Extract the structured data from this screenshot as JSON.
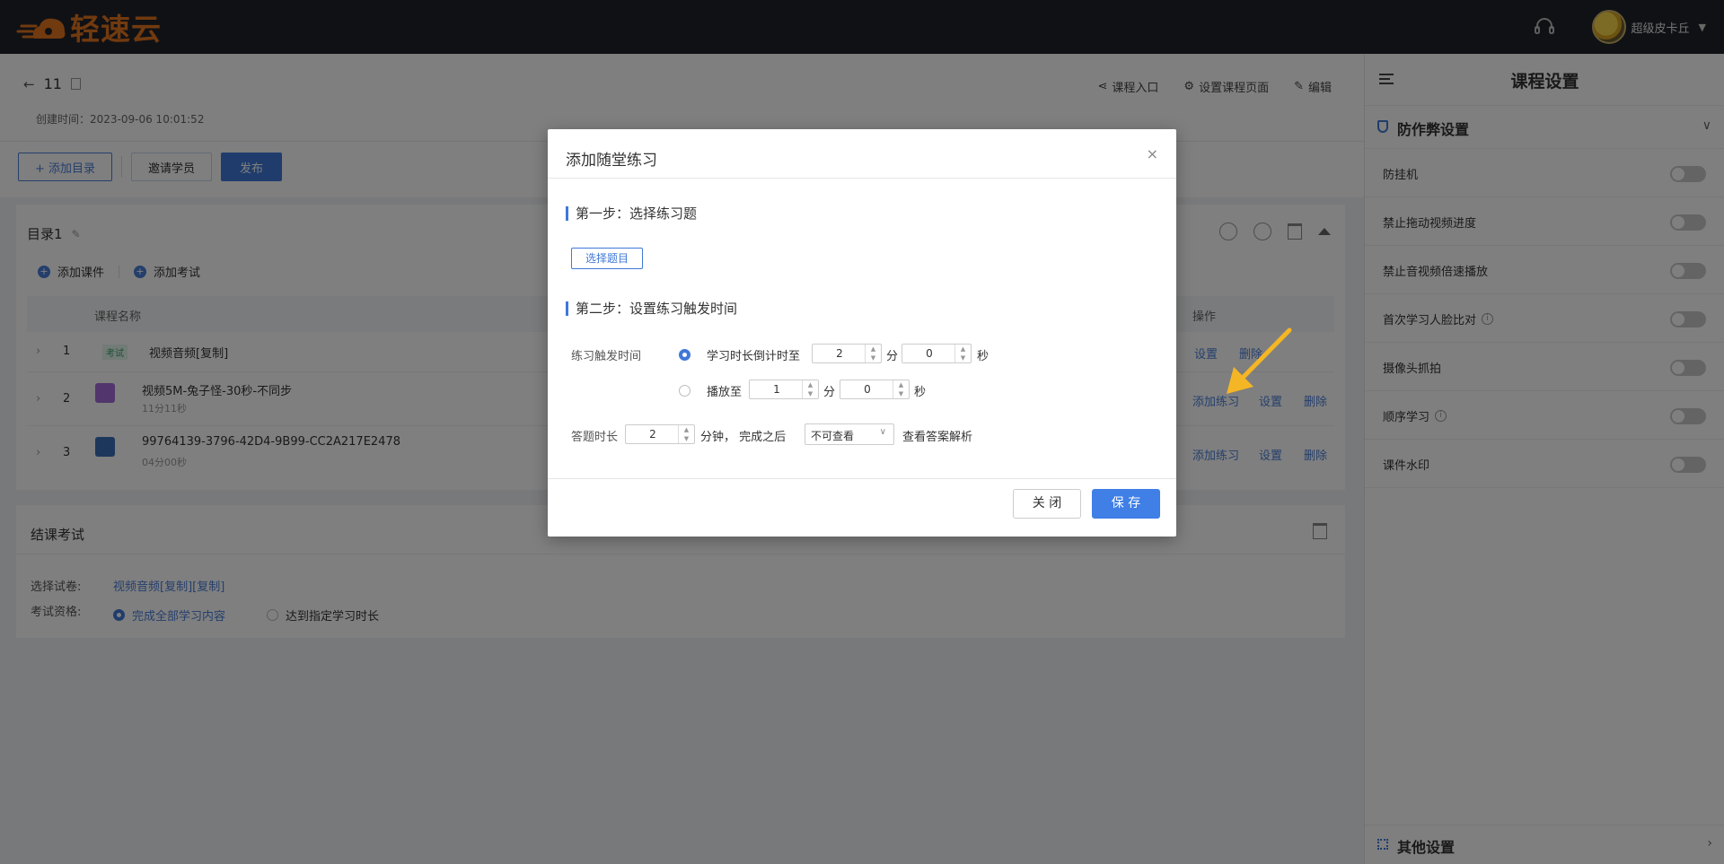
{
  "app": {
    "logo_text": "轻速云",
    "username": "超级皮卡丘"
  },
  "course": {
    "title": "11",
    "created": "创建时间：2023-09-06 10:01:52",
    "actions": [
      "课程入口",
      "设置课程页面",
      "编辑"
    ],
    "buttons": {
      "add_catalog": "+ 添加目录",
      "invite": "邀请学员",
      "publish": "发布"
    }
  },
  "catalog": {
    "title": "目录1",
    "add_courseware": "添加课件",
    "add_exam": "添加考试",
    "col_name": "课程名称",
    "col_ops": "操作",
    "rows": [
      {
        "num": "1",
        "tag": "考试",
        "title": "视频音频[复制]",
        "meta": "",
        "op1": "设置",
        "op2": "删除"
      },
      {
        "num": "2",
        "title": "视频5M-兔子怪-30秒-不同步",
        "meta": "11分11秒",
        "op0": "添加练习",
        "op1": "设置",
        "op2": "删除"
      },
      {
        "num": "3",
        "title": "99764139-3796-42D4-9B99-CC2A217E2478",
        "meta": "04分00秒",
        "op0": "添加练习",
        "op1": "设置",
        "op2": "删除"
      }
    ]
  },
  "exam": {
    "title": "结课考试",
    "paper_label": "选择试卷:",
    "paper_value": "视频音频[复制][复制]",
    "qual_label": "考试资格:",
    "opt1": "完成全部学习内容",
    "opt2": "达到指定学习时长"
  },
  "settings": {
    "title": "课程设置",
    "section": "防作弊设置",
    "items": [
      {
        "label": "防挂机",
        "info": false
      },
      {
        "label": "禁止拖动视频进度",
        "info": false
      },
      {
        "label": "禁止音视频倍速播放",
        "info": false
      },
      {
        "label": "首次学习人脸比对",
        "info": true
      },
      {
        "label": "摄像头抓拍",
        "info": false
      },
      {
        "label": "顺序学习",
        "info": true
      },
      {
        "label": "课件水印",
        "info": false
      }
    ],
    "other": "其他设置"
  },
  "modal": {
    "title": "添加随堂练习",
    "close_icon": "×",
    "step1": "第一步：选择练习题",
    "select_btn": "选择题目",
    "step2": "第二步：设置练习触发时间",
    "trigger_label": "练习触发时间",
    "opt1_label": "学习时长倒计时至",
    "opt1_min": "2",
    "opt1_sec": "0",
    "opt2_label": "播放至",
    "opt2_min": "1",
    "opt2_sec": "0",
    "unit_min": "分",
    "unit_sec": "秒",
    "answer_label": "答题时长",
    "answer_min": "2",
    "answer_suffix": "分钟，  完成之后",
    "answer_select": "不可查看",
    "answer_after": "查看答案解析",
    "btn_close": "关 闭",
    "btn_save": "保 存"
  },
  "colors": {
    "accent": "#3f78d8",
    "topbar": "#20232a",
    "logo": "#e2751f",
    "pointer": "#f5b625"
  }
}
